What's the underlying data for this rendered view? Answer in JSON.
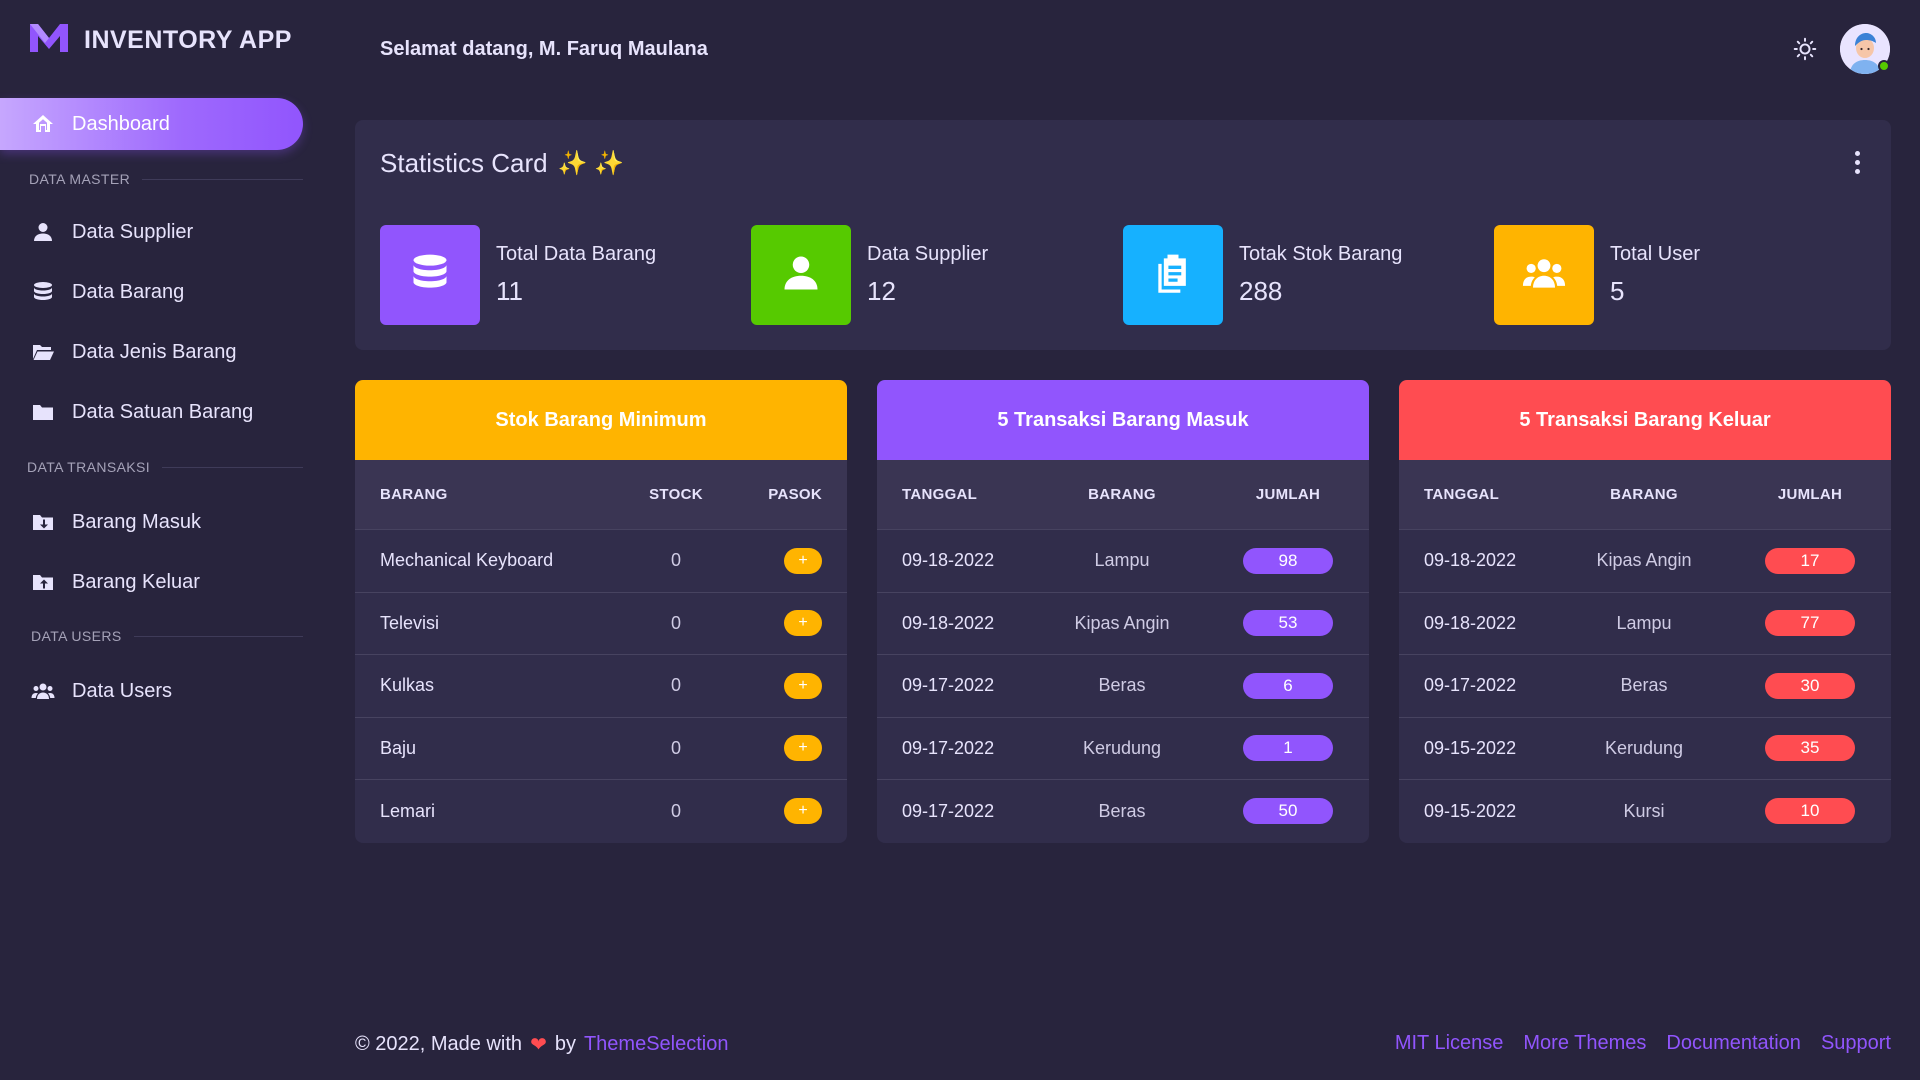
{
  "app": {
    "title": "INVENTORY APP",
    "logo_icon": "m-logo-icon"
  },
  "header": {
    "welcome": "Selamat datang, M. Faruq Maulana",
    "theme_icon": "sun-icon"
  },
  "sidebar": {
    "active": {
      "label": "Dashboard",
      "icon": "home-icon"
    },
    "sections": [
      {
        "title": "DATA MASTER",
        "items": [
          {
            "label": "Data Supplier",
            "icon": "user-icon"
          },
          {
            "label": "Data Barang",
            "icon": "database-icon"
          },
          {
            "label": "Data Jenis Barang",
            "icon": "folder-open-icon"
          },
          {
            "label": "Data Satuan Barang",
            "icon": "folder-icon"
          }
        ]
      },
      {
        "title": "DATA TRANSAKSI",
        "items": [
          {
            "label": "Barang Masuk",
            "icon": "folder-download-icon"
          },
          {
            "label": "Barang Keluar",
            "icon": "folder-upload-icon"
          }
        ]
      },
      {
        "title": "DATA USERS",
        "items": [
          {
            "label": "Data Users",
            "icon": "users-icon"
          }
        ]
      }
    ]
  },
  "stats": {
    "title": "Statistics Card",
    "sparkles": "✨ ✨",
    "items": [
      {
        "label": "Total Data Barang",
        "value": "11",
        "color": "#9155fd",
        "icon": "database-icon"
      },
      {
        "label": "Data Supplier",
        "value": "12",
        "color": "#56ca00",
        "icon": "user-icon"
      },
      {
        "label": "Totak Stok Barang",
        "value": "288",
        "color": "#16b1ff",
        "icon": "clipboard-icon"
      },
      {
        "label": "Total User",
        "value": "5",
        "color": "#ffb400",
        "icon": "users-icon"
      }
    ]
  },
  "stok_minimum": {
    "title": "Stok Barang Minimum",
    "color": "#ffb400",
    "columns": [
      "BARANG",
      "STOCK",
      "PASOK"
    ],
    "rows": [
      {
        "barang": "Mechanical Keyboard",
        "stock": "0",
        "pasok": "+"
      },
      {
        "barang": "Televisi",
        "stock": "0",
        "pasok": "+"
      },
      {
        "barang": "Kulkas",
        "stock": "0",
        "pasok": "+"
      },
      {
        "barang": "Baju",
        "stock": "0",
        "pasok": "+"
      },
      {
        "barang": "Lemari",
        "stock": "0",
        "pasok": "+"
      }
    ]
  },
  "masuk": {
    "title": "5 Transaksi Barang Masuk",
    "color": "#9155fd",
    "columns": [
      "TANGGAL",
      "BARANG",
      "JUMLAH"
    ],
    "rows": [
      {
        "tanggal": "09-18-2022",
        "barang": "Lampu",
        "jumlah": "98"
      },
      {
        "tanggal": "09-18-2022",
        "barang": "Kipas Angin",
        "jumlah": "53"
      },
      {
        "tanggal": "09-17-2022",
        "barang": "Beras",
        "jumlah": "6"
      },
      {
        "tanggal": "09-17-2022",
        "barang": "Kerudung",
        "jumlah": "1"
      },
      {
        "tanggal": "09-17-2022",
        "barang": "Beras",
        "jumlah": "50"
      }
    ]
  },
  "keluar": {
    "title": "5 Transaksi Barang Keluar",
    "color": "#ff4c51",
    "columns": [
      "TANGGAL",
      "BARANG",
      "JUMLAH"
    ],
    "rows": [
      {
        "tanggal": "09-18-2022",
        "barang": "Kipas Angin",
        "jumlah": "17"
      },
      {
        "tanggal": "09-18-2022",
        "barang": "Lampu",
        "jumlah": "77"
      },
      {
        "tanggal": "09-17-2022",
        "barang": "Beras",
        "jumlah": "30"
      },
      {
        "tanggal": "09-15-2022",
        "barang": "Kerudung",
        "jumlah": "35"
      },
      {
        "tanggal": "09-15-2022",
        "barang": "Kursi",
        "jumlah": "10"
      }
    ]
  },
  "footer": {
    "prefix": "© 2022, Made with",
    "heart": "❤",
    "by": "by",
    "author": "ThemeSelection",
    "links": [
      "MIT License",
      "More Themes",
      "Documentation",
      "Support"
    ]
  }
}
